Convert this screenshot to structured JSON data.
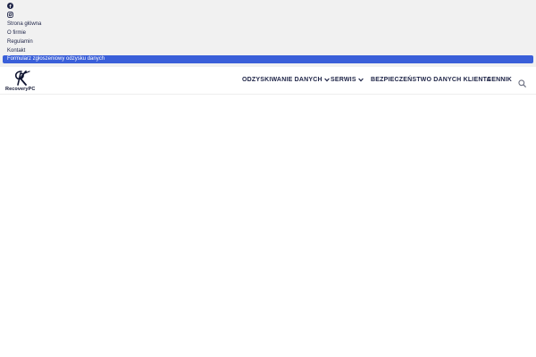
{
  "topbar": {
    "social": [
      {
        "icon": "facebook-icon"
      },
      {
        "icon": "instagram-icon"
      }
    ],
    "links": [
      {
        "label": "Strona główna"
      },
      {
        "label": "O firmie"
      },
      {
        "label": "Regulamin"
      },
      {
        "label": "Kontakt"
      },
      {
        "label": "Formularz zgłoszeniowy odzysku danych"
      }
    ]
  },
  "header": {
    "logo_text": "RecoveryPC",
    "nav": [
      {
        "label": "ODZYSKIWANIE DANYCH",
        "dropdown": true
      },
      {
        "label": "SERWIS",
        "dropdown": true
      },
      {
        "label": "BEZPIECZEŃSTWO DANYCH KLIENTA",
        "dropdown": false
      },
      {
        "label": "CENNIK",
        "dropdown": false
      }
    ],
    "search_icon": "search-icon"
  },
  "colors": {
    "accent": "#3a5fd9",
    "text": "#1d2346",
    "topbar_bg": "#f1f1f1"
  }
}
